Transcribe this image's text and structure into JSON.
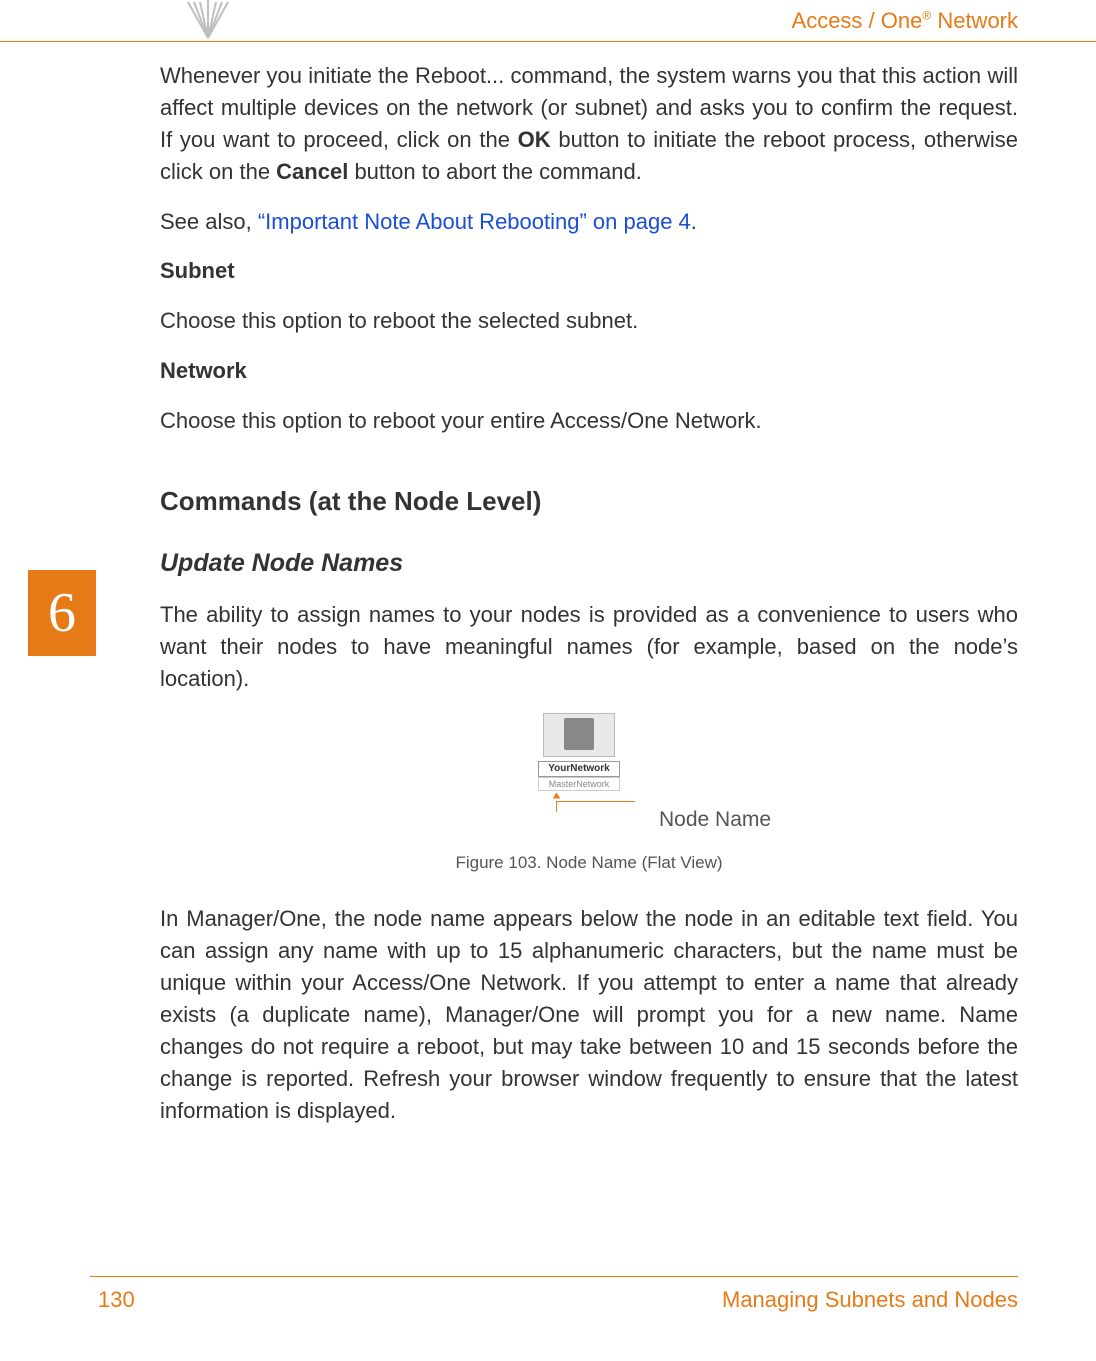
{
  "header": {
    "brand_prefix": "Access / One",
    "brand_suffix": " Network"
  },
  "chapter_number": "6",
  "body": {
    "reboot_intro_1": "Whenever you initiate the Reboot... command, the system warns you that this action will affect multiple devices on the network (or subnet) and asks you to confirm the request. If you want to proceed, click on the ",
    "reboot_ok": "OK",
    "reboot_intro_2": " button to initiate the reboot process, otherwise click on the ",
    "reboot_cancel": "Cancel",
    "reboot_intro_3": " button to abort the command.",
    "see_also_prefix": "See also, ",
    "see_also_link": "“Important Note About Rebooting” on page 4",
    "see_also_suffix": ".",
    "subnet_heading": "Subnet",
    "subnet_body": "Choose this option to reboot the selected subnet.",
    "network_heading": "Network",
    "network_body": "Choose this option to reboot your entire Access/One Network.",
    "commands_heading": "Commands (at the Node Level)",
    "update_heading": "Update Node Names",
    "update_body": "The ability to assign names to your nodes is provided as a convenience to users who want their nodes to have meaningful names (for example, based on the node’s location).",
    "manager_body": "In Manager/One, the node name appears below the node in an editable text field. You can assign any name with up to 15 alphanumeric characters, but the name must be unique within your Access/One Network. If you attempt to enter a name that already exists (a duplicate name), Manager/One will prompt you for a new name. Name changes do not require a reboot, but may take between 10 and 15 seconds before the change is reported. Refresh your browser window frequently to ensure that the latest information is displayed."
  },
  "figure": {
    "node_label_1": "YourNetwork",
    "node_label_2": "MasterNetwork",
    "callout": "Node Name",
    "caption": "Figure 103. Node Name (Flat View)"
  },
  "footer": {
    "page": "130",
    "section": "Managing Subnets and Nodes"
  }
}
